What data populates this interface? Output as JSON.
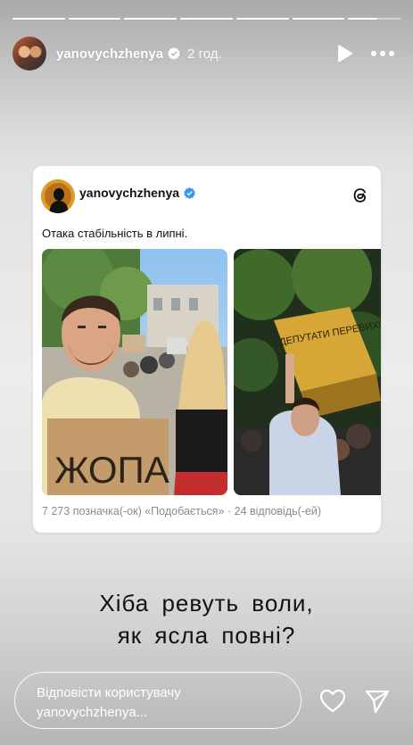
{
  "story": {
    "progress_segments": 7,
    "username": "yanovychzhenya",
    "time": "2 год.",
    "icons": {
      "verified": "verified-badge-icon",
      "play": "play-icon",
      "more": "more-icon"
    }
  },
  "post": {
    "username": "yanovychzhenya",
    "text": "Отака стабільність в липні.",
    "photo1_sign": "ЖОПА",
    "photo2_sign": "ДЕПУТАТИ ПЕРЕВИХОВАТЬСЯ",
    "stats": "7 273 позначка(-ок) «Подобається» · 24 відповідь(-ей)",
    "icons": {
      "threads": "threads-icon"
    }
  },
  "caption": {
    "line1": "Хіба ревуть воли,",
    "line2": "як ясла повні?"
  },
  "reply": {
    "line1": "Відповісти користувачу",
    "line2": "yanovychzhenya..."
  },
  "colors": {
    "verified": "#3897f0",
    "accent": "#ffffff"
  }
}
